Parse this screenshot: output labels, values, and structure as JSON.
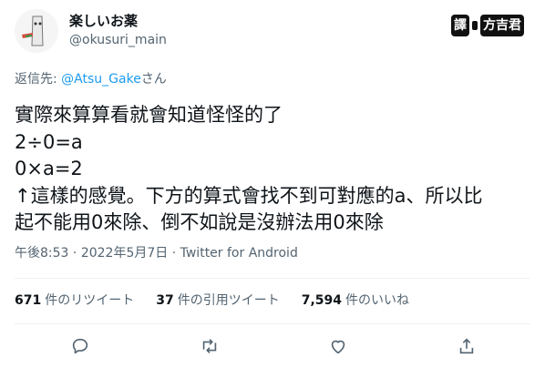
{
  "account": {
    "display_name": "楽しいお薬",
    "handle": "@okusuri_main"
  },
  "watermark": {
    "left": "譯",
    "right": "方吉君"
  },
  "reply_to": {
    "prefix": "返信先:",
    "mention": "@Atsu_Gake",
    "suffix": "さん"
  },
  "tweet": {
    "lines": [
      "實際來算算看就會知道怪怪的了",
      "2÷0=a",
      "0×a=2",
      "↑這樣的感覺。下方的算式會找不到可對應的a、所以比",
      "起不能用0來除、倒不如說是沒辦法用0來除"
    ]
  },
  "meta": {
    "time": "午後8:53",
    "separator": " · ",
    "date": "2022年5月7日",
    "source": "Twitter for Android"
  },
  "stats": {
    "retweets_count": "671",
    "retweets_label": "件のリツイート",
    "quotes_count": "37",
    "quotes_label": "件の引用ツイート",
    "likes_count": "7,594",
    "likes_label": "件のいいね"
  },
  "actions": {
    "reply_icon": "reply-icon",
    "retweet_icon": "retweet-icon",
    "like_icon": "heart-icon",
    "share_icon": "share-icon"
  },
  "colors": {
    "link": "#1d9bf0",
    "muted": "#536471",
    "text": "#0f1419"
  }
}
